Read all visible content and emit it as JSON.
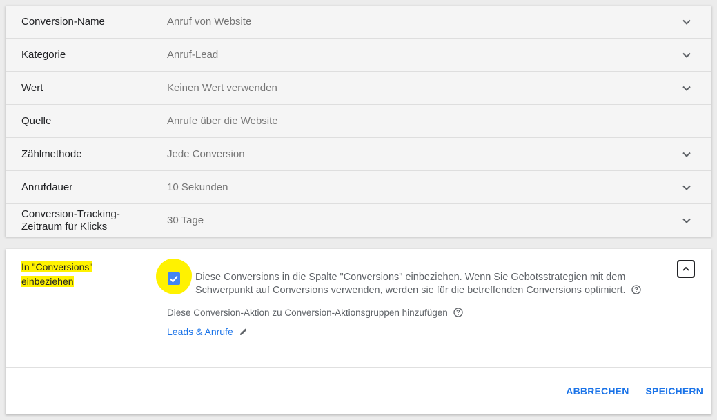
{
  "settings": [
    {
      "label": "Conversion-Name",
      "value": "Anruf von Website",
      "has_chevron": true
    },
    {
      "label": "Kategorie",
      "value": "Anruf-Lead",
      "has_chevron": true
    },
    {
      "label": "Wert",
      "value": "Keinen Wert verwenden",
      "has_chevron": true
    },
    {
      "label": "Quelle",
      "value": "Anrufe über die Website",
      "has_chevron": false
    },
    {
      "label": "Zählmethode",
      "value": "Jede Conversion",
      "has_chevron": true
    },
    {
      "label": "Anrufdauer",
      "value": "10 Sekunden",
      "has_chevron": true
    },
    {
      "label": "Conversion-Tracking-Zeitraum für Klicks",
      "value": "30 Tage",
      "has_chevron": true
    }
  ],
  "include_section": {
    "label_line1": "In \"Conversions\"",
    "label_line2": "einbeziehen",
    "checkbox_checked": true,
    "description": "Diese Conversions in die Spalte \"Conversions\" einbeziehen. Wenn Sie Gebotsstrategien mit dem Schwerpunkt auf Conversions verwenden, werden sie für die betreffenden Conversions optimiert.",
    "group_label": "Diese Conversion-Aktion zu Conversion-Aktionsgruppen hinzufügen",
    "group_link": "Leads & Anrufe"
  },
  "actions": {
    "cancel": "ABBRECHEN",
    "save": "SPEICHERN"
  },
  "colors": {
    "accent": "#1a73e8",
    "highlight": "#fff200",
    "checkbox": "#4285f4"
  },
  "icons": {
    "row_toggle": "chevron-down-icon",
    "collapse": "chevron-up-icon",
    "help": "help-circle-icon",
    "edit": "pencil-icon",
    "check": "check-icon"
  }
}
